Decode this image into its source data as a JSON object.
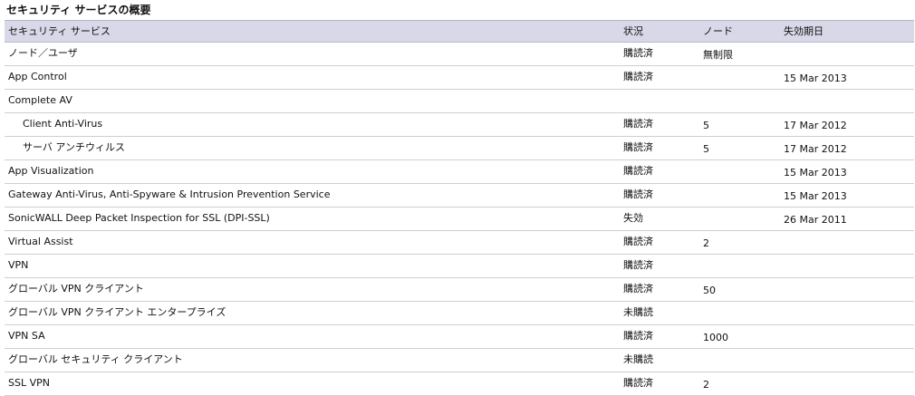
{
  "panel": {
    "title": "セキュリティ サービスの概要"
  },
  "table": {
    "columns": [
      "セキュリティ サービス",
      "状況",
      "ノード",
      "失効期日"
    ],
    "rows": [
      {
        "name": "ノード／ユーザ",
        "status": "購読済",
        "nodes": "無制限",
        "expiry": "",
        "indent": false
      },
      {
        "name": "App Control",
        "status": "購読済",
        "nodes": "",
        "expiry": "15 Mar 2013",
        "indent": false
      },
      {
        "name": "Complete AV",
        "status": "",
        "nodes": "",
        "expiry": "",
        "indent": false
      },
      {
        "name": "Client Anti-Virus",
        "status": "購読済",
        "nodes": "5",
        "expiry": "17 Mar 2012",
        "indent": true
      },
      {
        "name": "サーバ アンチウィルス",
        "status": "購読済",
        "nodes": "5",
        "expiry": "17 Mar 2012",
        "indent": true
      },
      {
        "name": "App Visualization",
        "status": "購読済",
        "nodes": "",
        "expiry": "15 Mar 2013",
        "indent": false
      },
      {
        "name": "Gateway Anti-Virus, Anti-Spyware & Intrusion Prevention Service",
        "status": "購読済",
        "nodes": "",
        "expiry": "15 Mar 2013",
        "indent": false
      },
      {
        "name": "SonicWALL Deep Packet Inspection for SSL (DPI-SSL)",
        "status": "失効",
        "nodes": "",
        "expiry": "26 Mar 2011",
        "indent": false
      },
      {
        "name": "Virtual Assist",
        "status": "購読済",
        "nodes": "2",
        "expiry": "",
        "indent": false
      },
      {
        "name": "VPN",
        "status": "購読済",
        "nodes": "",
        "expiry": "",
        "indent": false
      },
      {
        "name": "グローバル VPN クライアント",
        "status": "購読済",
        "nodes": "50",
        "expiry": "",
        "indent": false
      },
      {
        "name": "グローバル VPN クライアント エンタープライズ",
        "status": "未購読",
        "nodes": "",
        "expiry": "",
        "indent": false
      },
      {
        "name": "VPN SA",
        "status": "購読済",
        "nodes": "1000",
        "expiry": "",
        "indent": false
      },
      {
        "name": "グローバル セキュリティ クライアント",
        "status": "未購読",
        "nodes": "",
        "expiry": "",
        "indent": false
      },
      {
        "name": "SSL VPN",
        "status": "購読済",
        "nodes": "2",
        "expiry": "",
        "indent": false
      }
    ]
  }
}
